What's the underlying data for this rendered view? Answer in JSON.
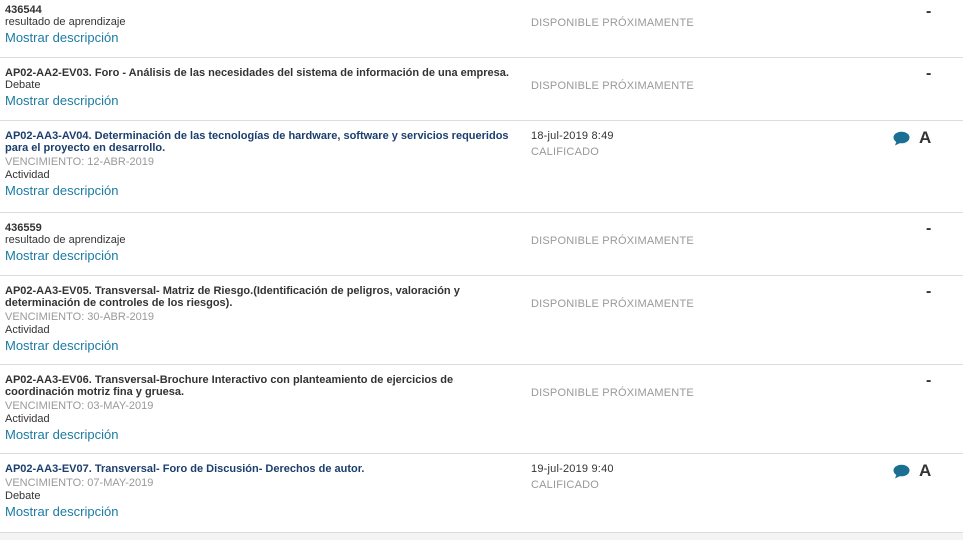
{
  "rows": [
    {
      "title": "436544",
      "type": "resultado de aprendizaje",
      "link": "Mostrar descripción",
      "status": "DISPONIBLE PRÓXIMAMENTE",
      "grade": "-"
    },
    {
      "title": "AP02-AA2-EV03. Foro - Análisis de las necesidades del sistema de información de una empresa.",
      "type": "Debate",
      "link": "Mostrar descripción",
      "status": "DISPONIBLE PRÓXIMAMENTE",
      "grade": "-"
    },
    {
      "title_line1": "AP02-AA3-AV04. Determinación de las tecnologías de hardware, software y servicios requeridos",
      "title_line2": "para el proyecto en desarrollo.",
      "due": "VENCIMIENTO: 12-ABR-2019",
      "type": "Actividad",
      "link": "Mostrar descripción",
      "date": "18-jul-2019 8:49",
      "status": "CALIFICADO",
      "grade": "A"
    },
    {
      "title": "436559",
      "type": "resultado de aprendizaje",
      "link": "Mostrar descripción",
      "status": "DISPONIBLE PRÓXIMAMENTE",
      "grade": "-"
    },
    {
      "title_line1": "AP02-AA3-EV05. Transversal- Matriz de Riesgo.(Identificación de peligros, valoración y",
      "title_line2": "determinación de controles de los riesgos).",
      "due": "VENCIMIENTO: 30-ABR-2019",
      "type": "Actividad",
      "link": "Mostrar descripción",
      "status": "DISPONIBLE PRÓXIMAMENTE",
      "grade": "-"
    },
    {
      "title_line1": "AP02-AA3-EV06. Transversal-Brochure Interactivo con planteamiento de ejercicios de",
      "title_line2": "coordinación motriz fina y gruesa.",
      "due": "VENCIMIENTO: 03-MAY-2019",
      "type": "Actividad",
      "link": "Mostrar descripción",
      "status": "DISPONIBLE PRÓXIMAMENTE",
      "grade": "-"
    },
    {
      "title": "AP02-AA3-EV07. Transversal- Foro de Discusión- Derechos de autor.",
      "due": "VENCIMIENTO: 07-MAY-2019",
      "type": "Debate",
      "link": "Mostrar descripción",
      "date": "19-jul-2019 9:40",
      "status": "CALIFICADO",
      "grade": "A"
    }
  ],
  "colors": {
    "link": "#1b7ba3",
    "title_link": "#1a3e6e",
    "muted": "#999999",
    "chat_icon": "#1b6f93"
  },
  "icons": {
    "comment": "comment-bubble-icon"
  }
}
